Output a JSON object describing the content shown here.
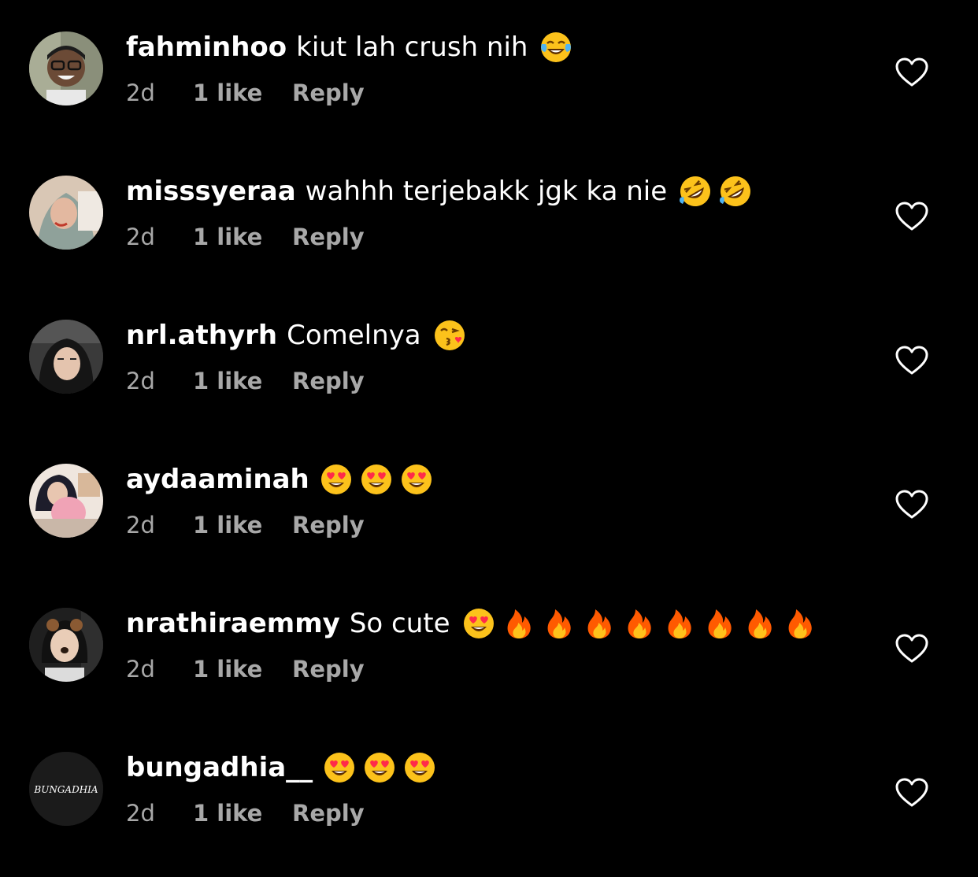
{
  "comments": [
    {
      "username": "fahminhoo",
      "text": "kiut lah crush nih",
      "emojis": [
        "face-with-tears-of-joy"
      ],
      "age": "2d",
      "likes": "1 like",
      "reply": "Reply"
    },
    {
      "username": "misssyeraa",
      "text": "wahhh terjebakk jgk ka nie",
      "emojis": [
        "rolling-on-floor-laughing",
        "rolling-on-floor-laughing"
      ],
      "age": "2d",
      "likes": "1 like",
      "reply": "Reply"
    },
    {
      "username": "nrl.athyrh",
      "text": "Comelnya",
      "emojis": [
        "face-blowing-a-kiss"
      ],
      "age": "2d",
      "likes": "1 like",
      "reply": "Reply"
    },
    {
      "username": "aydaaminah",
      "text": "",
      "emojis": [
        "heart-eyes",
        "heart-eyes",
        "heart-eyes"
      ],
      "age": "2d",
      "likes": "1 like",
      "reply": "Reply"
    },
    {
      "username": "nrathiraemmy",
      "text": "So cute",
      "emojis": [
        "heart-eyes",
        "fire",
        "fire",
        "fire",
        "fire",
        "fire",
        "fire",
        "fire",
        "fire"
      ],
      "age": "2d",
      "likes": "1 like",
      "reply": "Reply"
    },
    {
      "username": "bungadhia__",
      "text": "",
      "emojis": [
        "heart-eyes",
        "heart-eyes",
        "heart-eyes"
      ],
      "age": "2d",
      "likes": "1 like",
      "reply": "Reply",
      "avatar_logo_text": "BUNGADHIA"
    }
  ],
  "colors": {
    "background": "#000000",
    "primary_text": "#ffffff",
    "secondary_text": "#a8a8a8",
    "emoji_yellow": "#fcc21b",
    "heart_red": "#ff2a4a",
    "fire_orange": "#ff7a00"
  },
  "icons": {
    "like": "heart-outline-icon"
  }
}
